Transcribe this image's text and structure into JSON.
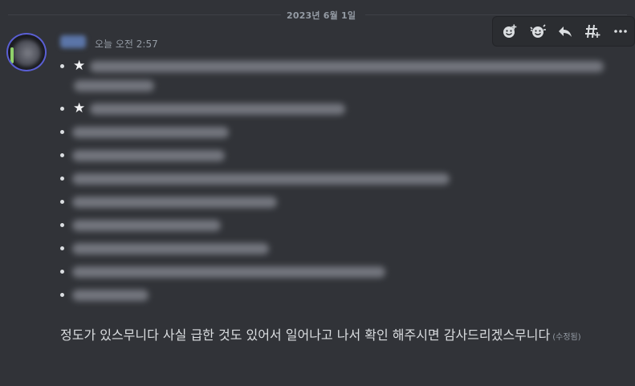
{
  "date_divider": {
    "label": "2023년 6월 1일"
  },
  "message": {
    "timestamp": "오늘 오전 2:57",
    "bullets": [
      {
        "star": "★"
      },
      {
        "star": "★"
      },
      {
        "star": ""
      },
      {
        "star": ""
      },
      {
        "star": ""
      },
      {
        "star": ""
      },
      {
        "star": ""
      },
      {
        "star": ""
      },
      {
        "star": ""
      },
      {
        "star": ""
      }
    ],
    "body_text": "정도가 있스무니다 사실 급한 것도 있어서 일어나고 나서 확인 해주시면 감사드리겠스무니다",
    "edited_label": "(수정됨)"
  },
  "toolbar": {
    "buttons": [
      {
        "icon": "add-reaction-icon"
      },
      {
        "icon": "super-reaction-icon"
      },
      {
        "icon": "reply-icon"
      },
      {
        "icon": "create-thread-icon"
      },
      {
        "icon": "more-options-icon"
      }
    ]
  },
  "colors": {
    "background": "#313338",
    "text": "#dbdee1",
    "muted": "#949ba4",
    "toolbar_bg": "#2b2d31"
  }
}
